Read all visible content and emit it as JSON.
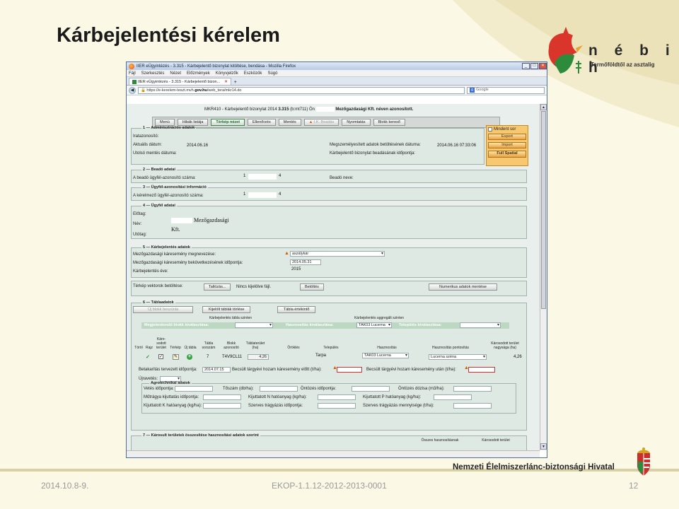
{
  "slide": {
    "title": "Kárbejelentési kérelem",
    "brand": "n é b i h",
    "tagline": "Termőföldtől az asztalig",
    "agency": "Nemzeti Élelmiszerlánc-biztonsági Hivatal",
    "footer_date": "2014.10.8-9.",
    "footer_code": "EKOP-1.1.12-2012-2013-0001",
    "footer_page": "12"
  },
  "colors": {
    "accent_green": "#3b8b46",
    "panel_orange": "#f7c870",
    "logo_red": "#d9352a"
  },
  "browser": {
    "title": "IIER eÜgyintézés - 3.315 - Kárbejelentő bizonylat kitöltése, bendása - Mozilla Firefox",
    "menu": [
      "Fájl",
      "Szerkesztés",
      "Nézet",
      "Előzmények",
      "Könyvjelzők",
      "Eszközök",
      "Súgó"
    ],
    "tabs": [
      {
        "label": "IIER eÜgyintézés - 3.315 - Kárbejelentő bizon..."
      }
    ],
    "url_prefix": "https://e-kerelem-teszt.mvh.",
    "url_domain": "gov.hu",
    "url_suffix": "/web_tera/mkr14.do",
    "search_placeholder": "Google"
  },
  "form": {
    "info_prefix": "MKR410 - Kárbejelentő bizonylat 2014",
    "info_code": "3.315",
    "info_mid": "(b:mt711) Ön",
    "info_suffix": "Mezőgazdasági Kft. néven azonosított.",
    "toolbar": [
      "Menü",
      "Hibák listája",
      "Térkép nézet",
      "Ellenőrzés",
      "Mentés",
      "I.K. Beadás",
      "Nyomtatás",
      "Blokk kereső"
    ],
    "side_panel": {
      "checkbox_label": "Mindent sor",
      "buttons": [
        "Export",
        "Import",
        "Full Spatial"
      ]
    },
    "sec1": {
      "legend": "1 — Adminisztrációs adatok",
      "label_iratazonosito": "Iratazonosító:",
      "label_aktualis": "Aktuális dátum:",
      "value_aktualis": "2014.06.16",
      "label_utolso": "Utolsó mentés dátuma:",
      "label_megszem": "Megszemélyesített adatok betöltésének dátuma:",
      "value_megszem": "2014.06.16 07:33:06",
      "label_beadas": "Kárbejelentő bizonylat beadásának időpontja:"
    },
    "sec2": {
      "legend": "2 — Beadó adatai",
      "label_ugyfel": "A beadó ügyfél-azonosító száma:",
      "id_a": "1",
      "id_b": "4",
      "label_nev": "Beadó neve:"
    },
    "sec3": {
      "legend": "3 — Ügyfél-azonosítási információ",
      "label_kerelmezo": "A kérelmező ügyfél-azonosító száma:",
      "id_a": "1",
      "id_b": "4"
    },
    "sec4": {
      "legend": "4 — Ügyfél adatai",
      "label_elotag": "Előtag:",
      "label_nev": "Név:",
      "label_utotag": "Utótag:",
      "name_a": "Mezőgazdasági",
      "name_b": "Kft."
    },
    "sec5": {
      "legend": "5 — Kárbejelentés adatok",
      "label_megnevezes": "Mezőgazdasági káresemény megnevezése:",
      "value_megnevezes": "aszálykár",
      "label_idopont": "Mezőgazdasági káresemény bekövetkezésének időpontja:",
      "value_idopont": "2014.05.31",
      "label_ev": "Kárbejelentés éve:",
      "value_ev": "2015"
    },
    "map": {
      "label": "Térkép vektorok betöltése:",
      "browse": "Tallózás...",
      "no_file": "Nincs kijelölve fájl.",
      "load": "Betöltés",
      "numeric": "Numerikus adatok mentése"
    },
    "sec6": {
      "legend": "6 — Táblaadatok",
      "btn_new": "Új blokk beszúrás",
      "btn_delete": "Kijelölt táblák törlése",
      "btn_inventory": "Tábla értékintő",
      "hdr_level": "Kárbejelentés tábla szinten",
      "hdr_aggregate": "Kárbejelentés aggregált szinten",
      "label_block_select": "Megjelenítendő blokk kiválasztása:",
      "label_use_select": "Hasznosítás kiválasztása:",
      "use_value": "TAK03 Lucerna",
      "label_settlement": "Település kiválasztása:",
      "columns": [
        "Töröl",
        "Rajz",
        "Káro-sodott terület",
        "Térkép",
        "Új tábla",
        "Tábla sorszám",
        "Blokk azonosító",
        "Táblaterület (ha)",
        "Öröklés",
        "Település",
        "Hasznosítás",
        "Hasznosítás pontosítás",
        "Károsodott terület nagysága (ha)"
      ],
      "row": {
        "sorszam": "7",
        "blokk": "T4V9CL11",
        "terulet": "4,26",
        "telepules": "Tarpa",
        "hasznositas": "TAK03 Lucerna",
        "pontositas": "Lucerna széna",
        "karos": "4,26"
      },
      "label_betakaritas": "Betakarítás tervezett időpontja:",
      "value_betakaritas": "2014.07.15",
      "label_hozam_elott": "Becsült tárgyévi hozam káresemény előtt (t/ha):",
      "label_hozam_utan": "Becsült tárgyévi hozam káresemény után (t/ha):",
      "label_ujravetes": "Újravetés:",
      "agro_legend": "Agrotechnikai adatok",
      "label_vetes": "Vetés időpontja:",
      "label_toszam": "Tőszám (db/ha):",
      "label_ontozes": "Öntözés időpontja:",
      "label_ontozes_dozis": "Öntözés dózisa (m3/ha):",
      "label_mutragya": "Műtrágya kijuttatás időpontja:",
      "label_n": "Kijuttatott N hatóanyag (kg/ha):",
      "label_p": "Kijuttatott P hatóanyag (kg/ha):",
      "label_k": "Kijuttatott K hatóanyag (kg/ha):",
      "label_szerves_ido": "Szerves trágyázás időpontja:",
      "label_szerves_menny": "Szerves trágyázás mennyisége (t/ha):"
    },
    "sec7": {
      "legend": "7 — Károsult területek összesítése hasznosítási adatok szerint",
      "col_a": "Összes hasznosításnak",
      "col_b": "Károsodott terület"
    }
  }
}
